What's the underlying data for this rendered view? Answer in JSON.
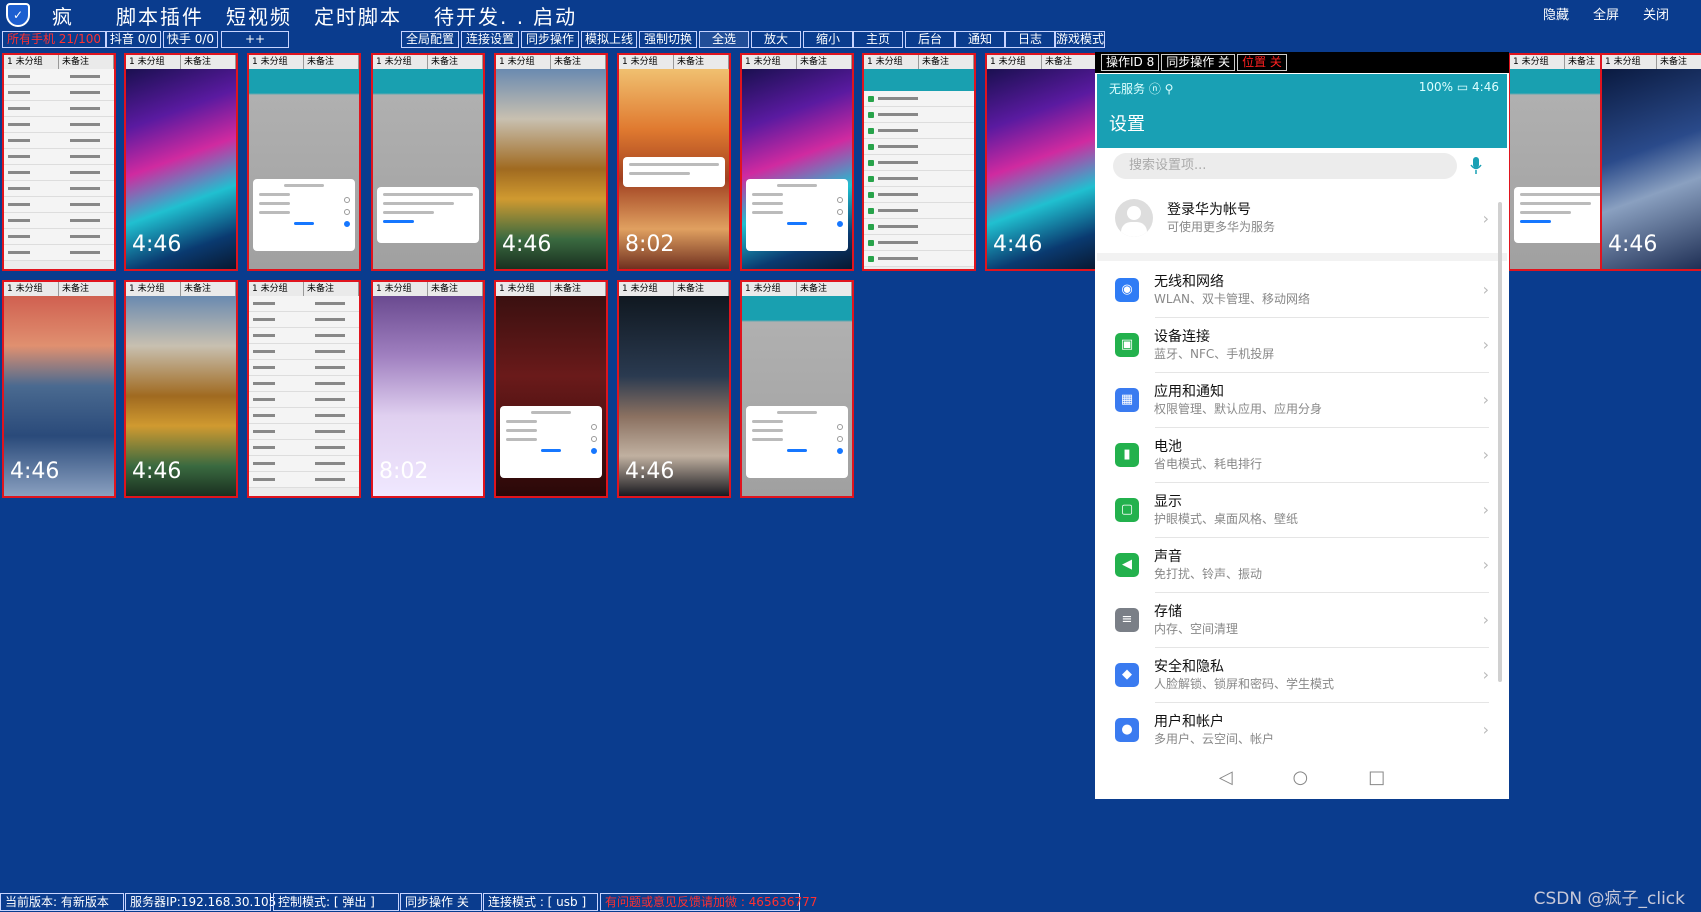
{
  "menu": {
    "app_icon": "shield-icon",
    "items": [
      "疯",
      "脚本插件",
      "短视频",
      "定时脚本",
      "待开发. .",
      "启动"
    ],
    "window": {
      "hide": "隐藏",
      "fullscreen": "全屏",
      "close": "关闭"
    }
  },
  "toolbar": {
    "all_phones": "所有手机 21/100",
    "douyin": "抖音 0/0",
    "kuaishou": "快手 0/0",
    "plus": "++",
    "buttons": [
      "全局配置",
      "连接设置",
      "同步操作",
      "模拟上线",
      "强制切换",
      "全选",
      "放大",
      "缩小",
      "主页",
      "后台",
      "通知",
      "日志",
      "游戏模式"
    ]
  },
  "phone_header": {
    "group": "1 未分组",
    "note": "未备注"
  },
  "phone_times": {
    "t446": "4:46",
    "t802": "8:02"
  },
  "big_panel": {
    "op_id": "操作ID  8",
    "sync": "同步操作  关",
    "position": "位置  关",
    "status_left": "无服务 ⓝ ⚲",
    "status_right": "100% ▭ 4:46",
    "title": "设置",
    "search_placeholder": "搜索设置项...",
    "account": {
      "title": "登录华为帐号",
      "sub": "可使用更多华为服务"
    },
    "settings": [
      {
        "title": "无线和网络",
        "sub": "WLAN、双卡管理、移动网络",
        "icon": "wifi-icon",
        "color": "#2f7cf5"
      },
      {
        "title": "设备连接",
        "sub": "蓝牙、NFC、手机投屏",
        "icon": "device-connect-icon",
        "color": "#23b14d"
      },
      {
        "title": "应用和通知",
        "sub": "权限管理、默认应用、应用分身",
        "icon": "apps-icon",
        "color": "#3a7bf0"
      },
      {
        "title": "电池",
        "sub": "省电模式、耗电排行",
        "icon": "battery-icon",
        "color": "#23b14d"
      },
      {
        "title": "显示",
        "sub": "护眼模式、桌面风格、壁纸",
        "icon": "display-icon",
        "color": "#23b14d"
      },
      {
        "title": "声音",
        "sub": "免打扰、铃声、振动",
        "icon": "sound-icon",
        "color": "#23b14d"
      },
      {
        "title": "存储",
        "sub": "内存、空间清理",
        "icon": "storage-icon",
        "color": "#7a7f87"
      },
      {
        "title": "安全和隐私",
        "sub": "人脸解锁、锁屏和密码、学生模式",
        "icon": "security-icon",
        "color": "#3a7bf0"
      },
      {
        "title": "用户和帐户",
        "sub": "多用户、云空间、帐户",
        "icon": "user-icon",
        "color": "#3a7bf0"
      }
    ],
    "nav": {
      "back": "◁",
      "home": "○",
      "recent": "□"
    }
  },
  "bottom": {
    "version": "当前版本:  有新版本",
    "server": "服务器IP:192.168.30.105",
    "control": "控制模式:  [ 弹出 ]",
    "sync": "同步操作  关",
    "conn": "连接模式 :  [ usb ]",
    "feedback": "有问题或意见反馈请加微 : 465636777"
  },
  "watermark": "CSDN @疯子_click"
}
